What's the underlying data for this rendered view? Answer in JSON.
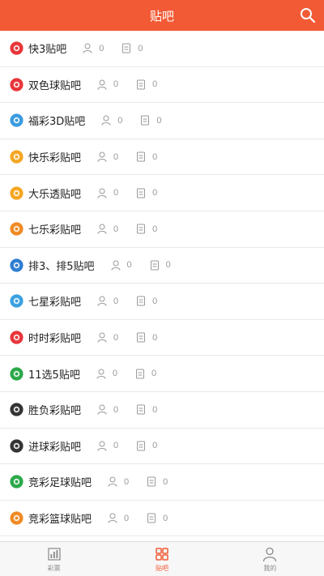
{
  "header": {
    "title": "贴吧",
    "search_icon": "search-icon"
  },
  "colors": {
    "accent": "#f25a35",
    "divider": "#e8e8e8",
    "muted": "#9a9a9a"
  },
  "forums": [
    {
      "name": "快3贴吧",
      "members": "0",
      "posts": "0",
      "icon": "kuai3-logo",
      "color": "#e8353a"
    },
    {
      "name": "双色球贴吧",
      "members": "0",
      "posts": "0",
      "icon": "shuangseqiu-logo",
      "color": "#e8353a"
    },
    {
      "name": "福彩3D贴吧",
      "members": "0",
      "posts": "0",
      "icon": "fucai3d-logo",
      "color": "#3a9be0"
    },
    {
      "name": "快乐彩贴吧",
      "members": "0",
      "posts": "0",
      "icon": "kuailecai-logo",
      "color": "#f5a623"
    },
    {
      "name": "大乐透贴吧",
      "members": "0",
      "posts": "0",
      "icon": "daletou-logo",
      "color": "#f5a623"
    },
    {
      "name": "七乐彩贴吧",
      "members": "0",
      "posts": "0",
      "icon": "qilecai-logo",
      "color": "#f08a24"
    },
    {
      "name": "排3、排5贴吧",
      "members": "0",
      "posts": "0",
      "icon": "pai35-logo",
      "color": "#2e7dd1"
    },
    {
      "name": "七星彩贴吧",
      "members": "0",
      "posts": "0",
      "icon": "qixingcai-logo",
      "color": "#3aa0e0"
    },
    {
      "name": "时时彩贴吧",
      "members": "0",
      "posts": "0",
      "icon": "shishicai-logo",
      "color": "#e8353a"
    },
    {
      "name": "11选5贴吧",
      "members": "0",
      "posts": "0",
      "icon": "11xuan5-logo",
      "color": "#2aa84a"
    },
    {
      "name": "胜负彩贴吧",
      "members": "0",
      "posts": "0",
      "icon": "shengfucai-logo",
      "color": "#333333"
    },
    {
      "name": "进球彩贴吧",
      "members": "0",
      "posts": "0",
      "icon": "jinqiucai-logo",
      "color": "#333333"
    },
    {
      "name": "竞彩足球贴吧",
      "members": "0",
      "posts": "0",
      "icon": "jingcaizuqiu-logo",
      "color": "#2aa84a"
    },
    {
      "name": "竞彩篮球贴吧",
      "members": "0",
      "posts": "0",
      "icon": "jingcailanqiu-logo",
      "color": "#f08a24"
    }
  ],
  "tabbar": {
    "tabs": [
      {
        "label": "彩票",
        "icon": "chart-icon",
        "active": false
      },
      {
        "label": "贴吧",
        "icon": "grid-icon",
        "active": true
      },
      {
        "label": "我的",
        "icon": "user-icon",
        "active": false
      }
    ]
  }
}
